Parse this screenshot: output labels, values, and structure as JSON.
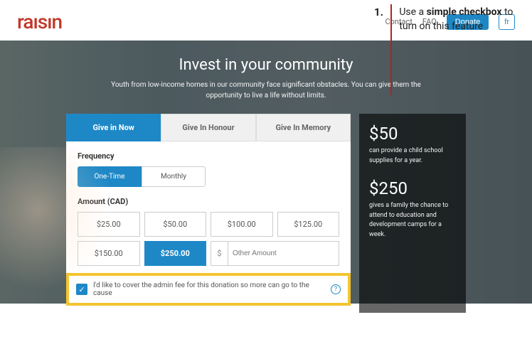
{
  "annotation": {
    "number": "1.",
    "text_prefix": "Use a ",
    "text_bold": "simple checkbox",
    "text_suffix": " to turn on this feature"
  },
  "header": {
    "logo": "raısın",
    "links": {
      "contact": "Contact",
      "faq": "FAQ"
    },
    "donate": "Donate",
    "lang": "fr"
  },
  "hero": {
    "title": "Invest in your community",
    "subtitle": "Youth from low-income homes in our community face significant obstacles. You can give them the opportunity to live a life without limits."
  },
  "tabs": [
    "Give in Now",
    "Give In Honour",
    "Give In Memory"
  ],
  "frequency": {
    "label": "Frequency",
    "options": [
      "One-Time",
      "Monthly"
    ]
  },
  "amount": {
    "label": "Amount (CAD)",
    "options": [
      "$25.00",
      "$50.00",
      "$100.00",
      "$125.00",
      "$150.00",
      "$250.00"
    ],
    "prefix": "$",
    "other_placeholder": "Other Amount"
  },
  "fee": {
    "label": "I'd like to cover the admin fee for this donation so more can go to the cause",
    "help": "?"
  },
  "sidebar": [
    {
      "amount": "$50",
      "desc": "can provide a child school supplies for a year."
    },
    {
      "amount": "$250",
      "desc": "gives a family the chance to attend to education and development camps for a week."
    }
  ]
}
